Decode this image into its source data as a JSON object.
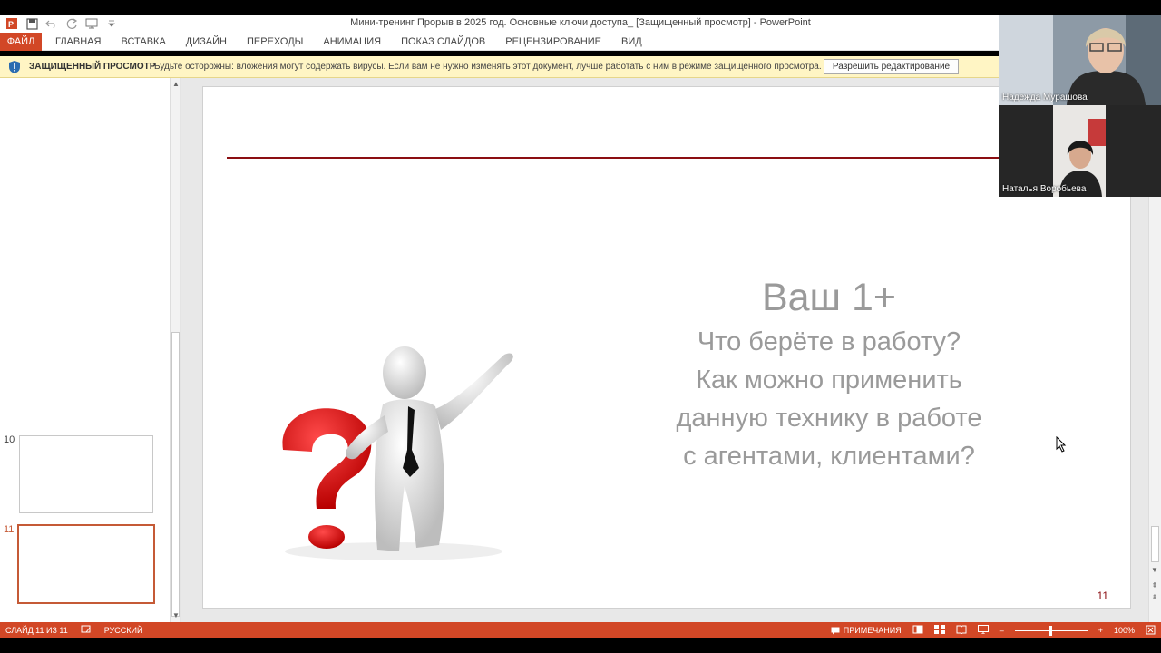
{
  "window": {
    "title": "Мини-тренинг Прорыв в 2025 год. Основные ключи доступа_ [Защищенный просмотр] - PowerPoint"
  },
  "qat": {
    "items": [
      "powerpoint-logo",
      "save-icon",
      "undo-icon",
      "redo-icon",
      "start-from-beginning-icon",
      "customize-qat-icon"
    ]
  },
  "ribbon": {
    "file_tab": "ФАЙЛ",
    "tabs": [
      "ГЛАВНАЯ",
      "ВСТАВКА",
      "ДИЗАЙН",
      "ПЕРЕХОДЫ",
      "АНИМАЦИЯ",
      "ПОКАЗ СЛАЙДОВ",
      "РЕЦЕНЗИРОВАНИЕ",
      "ВИД"
    ]
  },
  "protected_view": {
    "title": "ЗАЩИЩЕННЫЙ ПРОСМОТР",
    "message": "Будьте осторожны: вложения могут содержать вирусы. Если вам не нужно изменять этот документ, лучше работать с ним в режиме защищенного просмотра.",
    "enable_button": "Разрешить редактирование"
  },
  "thumbnails": [
    {
      "number": "10",
      "active": false
    },
    {
      "number": "11",
      "active": true
    }
  ],
  "slide": {
    "heading": "Ваш 1+",
    "lines": [
      "Что берёте в работу?",
      "Как можно применить",
      "данную технику в работе",
      "с агентами, клиентами?"
    ],
    "number": "11"
  },
  "video": {
    "participants": [
      {
        "name": "Надежда Мурашова"
      },
      {
        "name": "Наталья Воробьева"
      }
    ]
  },
  "status": {
    "slide_info": "СЛАЙД 11 ИЗ 11",
    "language": "РУССКИЙ",
    "notes": "ПРИМЕЧАНИЯ",
    "zoom": "100%"
  },
  "colors": {
    "accent": "#d24726",
    "slide_line": "#8b0e12",
    "protected_bar": "#fff5c4"
  }
}
